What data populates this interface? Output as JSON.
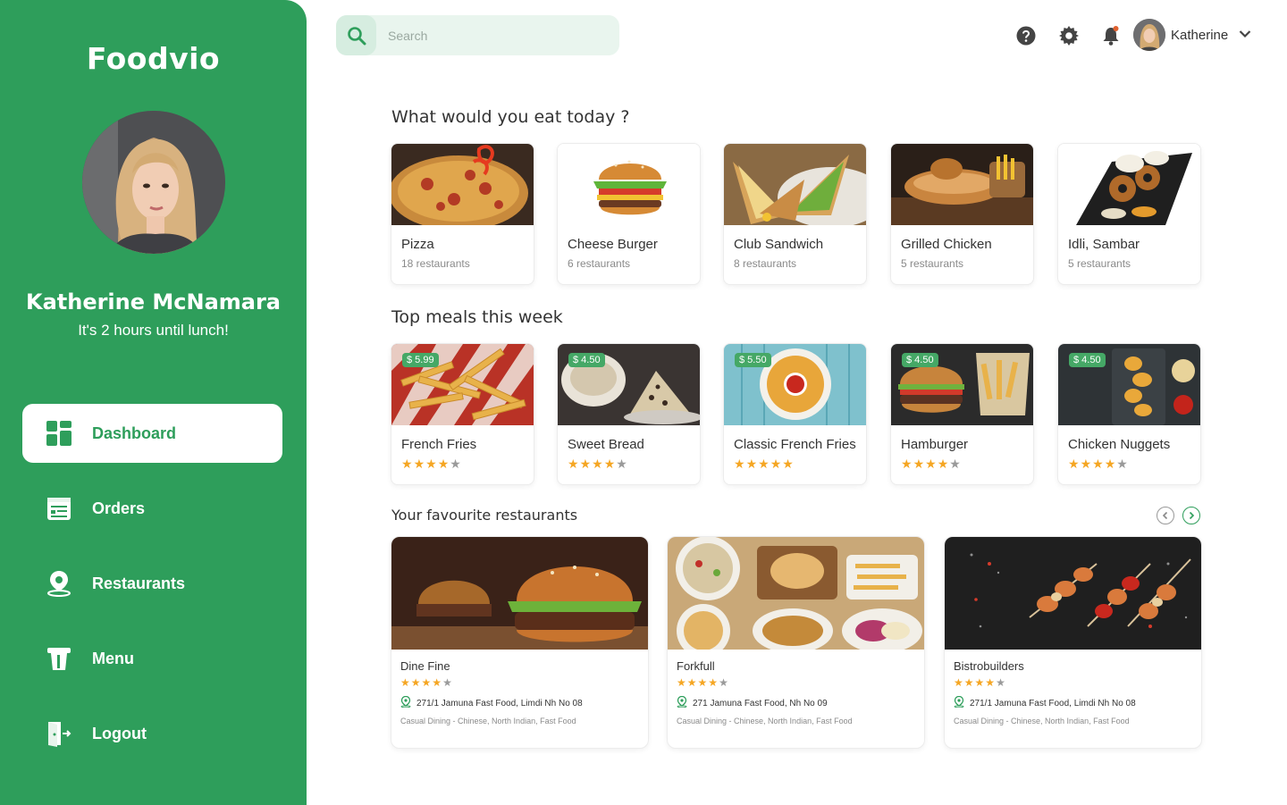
{
  "brand": "Foodvio",
  "profile": {
    "name": "Katherine McNamara",
    "subtitle": "It's 2 hours until lunch!"
  },
  "nav": [
    {
      "label": "Dashboard",
      "icon": "dashboard-icon",
      "active": true
    },
    {
      "label": "Orders",
      "icon": "orders-icon",
      "active": false
    },
    {
      "label": "Restaurants",
      "icon": "location-pin-icon",
      "active": false
    },
    {
      "label": "Menu",
      "icon": "menu-icon",
      "active": false
    },
    {
      "label": "Logout",
      "icon": "logout-icon",
      "active": false
    }
  ],
  "search": {
    "placeholder": "Search",
    "value": ""
  },
  "header": {
    "user_name": "Katherine"
  },
  "sections": {
    "eat_today": "What would you eat today ?",
    "top_meals": "Top meals this week",
    "favourites": "Your favourite restaurants"
  },
  "categories": [
    {
      "name": "Pizza",
      "count": "18 restaurants"
    },
    {
      "name": "Cheese Burger",
      "count": "6 restaurants"
    },
    {
      "name": "Club Sandwich",
      "count": "8 restaurants"
    },
    {
      "name": "Grilled Chicken",
      "count": "5 restaurants"
    },
    {
      "name": "Idli, Sambar",
      "count": "5 restaurants"
    }
  ],
  "meals": [
    {
      "name": "French Fries",
      "price": "$ 5.99",
      "rating": 4
    },
    {
      "name": "Sweet Bread",
      "price": "$ 4.50",
      "rating": 4
    },
    {
      "name": "Classic French Fries",
      "price": "$ 5.50",
      "rating": 5
    },
    {
      "name": "Hamburger",
      "price": "$ 4.50",
      "rating": 4
    },
    {
      "name": "Chicken Nuggets",
      "price": "$ 4.50",
      "rating": 4
    }
  ],
  "restaurants": [
    {
      "name": "Dine Fine",
      "rating": 4,
      "address": "271/1 Jamuna Fast Food, Limdi Nh No 08",
      "category": "Casual Dining - Chinese, North Indian, Fast Food"
    },
    {
      "name": "Forkfull",
      "rating": 4,
      "address": "271 Jamuna Fast Food,  Nh No 09",
      "category": "Casual Dining - Chinese, North Indian, Fast Food"
    },
    {
      "name": "Bistrobuilders",
      "rating": 4,
      "address": "271/1 Jamuna Fast Food, Limdi Nh No 08",
      "category": "Casual Dining - Chinese, North Indian, Fast Food"
    }
  ],
  "colors": {
    "primary": "#2e9e5b",
    "star": "#f5a623",
    "badge": "#45a866"
  }
}
